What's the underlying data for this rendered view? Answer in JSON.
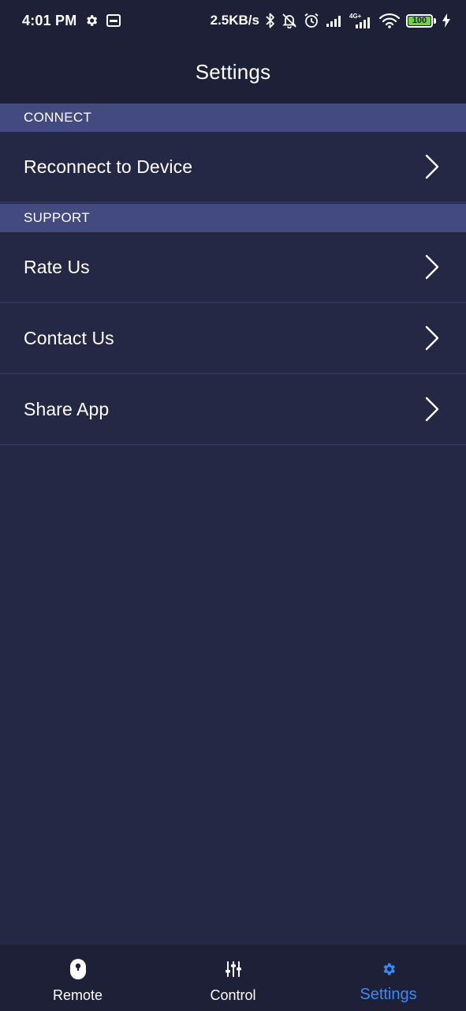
{
  "status_bar": {
    "time": "4:01 PM",
    "speed": "2.5KB/s",
    "network_label": "4G+",
    "battery": "100",
    "icons": [
      "gear-icon",
      "voicemail-icon",
      "bluetooth-icon",
      "bell-off-icon",
      "alarm-icon",
      "signal-icon",
      "signal-4g-icon",
      "wifi-icon",
      "battery-icon",
      "charging-icon"
    ]
  },
  "header": {
    "title": "Settings"
  },
  "sections": {
    "connect": {
      "title": "CONNECT",
      "items": [
        {
          "label": "Reconnect to Device",
          "icon": "chevron-right-icon"
        }
      ]
    },
    "support": {
      "title": "SUPPORT",
      "items": [
        {
          "label": "Rate Us",
          "icon": "chevron-right-icon"
        },
        {
          "label": "Contact Us",
          "icon": "chevron-right-icon"
        },
        {
          "label": "Share App",
          "icon": "chevron-right-icon"
        }
      ]
    }
  },
  "bottom_nav": {
    "items": [
      {
        "label": "Remote",
        "icon": "remote-icon",
        "active": false
      },
      {
        "label": "Control",
        "icon": "sliders-icon",
        "active": false
      },
      {
        "label": "Settings",
        "icon": "gear-icon",
        "active": true
      }
    ],
    "active_color": "#3d8af7"
  },
  "colors": {
    "background": "#242845",
    "header_bg": "#1d2036",
    "section_bg": "#424a7f",
    "divider": "#303658"
  }
}
